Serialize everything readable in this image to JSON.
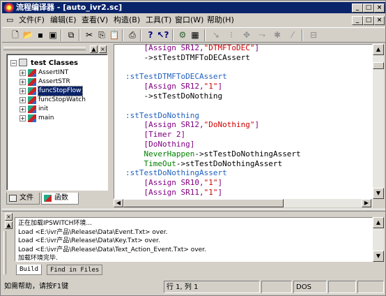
{
  "window": {
    "title": "流程编译器 - [auto_ivr2.sc]",
    "min": "_",
    "max": "□",
    "close": "×",
    "doc_min": "_",
    "doc_max": "□",
    "doc_close": "×"
  },
  "menu": [
    "文件(F)",
    "编辑(E)",
    "查看(V)",
    "构造(B)",
    "工具(T)",
    "窗口(W)",
    "帮助(H)"
  ],
  "tree": {
    "root": "test Classes",
    "items": [
      "AssertINT",
      "AssertSTR",
      "funcStopFlow",
      "funcStopWatch",
      "init",
      "main"
    ],
    "selected": "funcStopFlow"
  },
  "left_tabs": [
    "文件",
    "函数"
  ],
  "code_lines": [
    {
      "indent": "    ",
      "parts": [
        {
          "t": "[Assign SR12,",
          "c": "#800080"
        },
        {
          "t": "\"DTMFToDEC\"",
          "c": "#d00000"
        },
        {
          "t": "]",
          "c": "#800080"
        }
      ]
    },
    {
      "indent": "    ",
      "parts": [
        {
          "t": "->stTestDTMFToDECAssert",
          "c": "#000000"
        }
      ]
    },
    {
      "indent": "",
      "parts": [
        {
          "t": "",
          "c": "#000"
        }
      ]
    },
    {
      "indent": "",
      "parts": [
        {
          "t": ":stTestDTMFToDECAssert",
          "c": "#2060c0"
        }
      ]
    },
    {
      "indent": "    ",
      "parts": [
        {
          "t": "[Assign SR12,",
          "c": "#800080"
        },
        {
          "t": "\"1\"",
          "c": "#d00000"
        },
        {
          "t": "]",
          "c": "#800080"
        }
      ]
    },
    {
      "indent": "    ",
      "parts": [
        {
          "t": "->stTestDoNothing",
          "c": "#000000"
        }
      ]
    },
    {
      "indent": "",
      "parts": [
        {
          "t": "",
          "c": "#000"
        }
      ]
    },
    {
      "indent": "",
      "parts": [
        {
          "t": ":stTestDoNothing",
          "c": "#2060c0"
        }
      ]
    },
    {
      "indent": "    ",
      "parts": [
        {
          "t": "[Assign SR12,",
          "c": "#800080"
        },
        {
          "t": "\"DoNothing\"",
          "c": "#d00000"
        },
        {
          "t": "]",
          "c": "#800080"
        }
      ]
    },
    {
      "indent": "    ",
      "parts": [
        {
          "t": "[Timer 2]",
          "c": "#800080"
        }
      ]
    },
    {
      "indent": "    ",
      "parts": [
        {
          "t": "[DoNothing]",
          "c": "#800080"
        }
      ]
    },
    {
      "indent": "    ",
      "parts": [
        {
          "t": "NeverHappen",
          "c": "#008000"
        },
        {
          "t": "->stTestDoNothingAssert",
          "c": "#000000"
        }
      ]
    },
    {
      "indent": "    ",
      "parts": [
        {
          "t": "TimeOut",
          "c": "#008000"
        },
        {
          "t": "->stTestDoNothingAssert",
          "c": "#000000"
        }
      ]
    },
    {
      "indent": "",
      "parts": [
        {
          "t": ":stTestDoNothingAssert",
          "c": "#2060c0"
        }
      ]
    },
    {
      "indent": "    ",
      "parts": [
        {
          "t": "[Assign SR10,",
          "c": "#800080"
        },
        {
          "t": "\"1\"",
          "c": "#d00000"
        },
        {
          "t": "]",
          "c": "#800080"
        }
      ]
    },
    {
      "indent": "    ",
      "parts": [
        {
          "t": "[Assign SR11,",
          "c": "#800080"
        },
        {
          "t": "\"1\"",
          "c": "#d00000"
        },
        {
          "t": "]",
          "c": "#800080"
        }
      ]
    }
  ],
  "output": {
    "lines": [
      "正在加载IPSWITCH环境...",
      "Load <E:\\ivr产品\\Release\\Data\\Event.Txt> over.",
      "Load <E:\\ivr产品\\Release\\Data\\Key.Txt> over.",
      "Load <E:\\ivr产品\\Release\\Data\\Text_Action_Event.Txt> over.",
      "加载环境完毕."
    ],
    "tabs": [
      "Build",
      "Find in Files"
    ]
  },
  "status": {
    "help": "如需帮助，请按F1键",
    "position": "行 1, 列 1",
    "mode": "DOS"
  },
  "icons": [
    "new-file-icon",
    "open-folder-icon",
    "save-icon",
    "save-all-icon",
    "copy-window-icon",
    "cut-icon",
    "copy-icon",
    "paste-icon",
    "print-icon",
    "help-icon",
    "context-help-icon",
    "compile-icon",
    "build-icon",
    "run-icon",
    "step-icon",
    "breakpoint-icon",
    "debug-icon",
    "toggle-icon",
    "options-icon"
  ]
}
